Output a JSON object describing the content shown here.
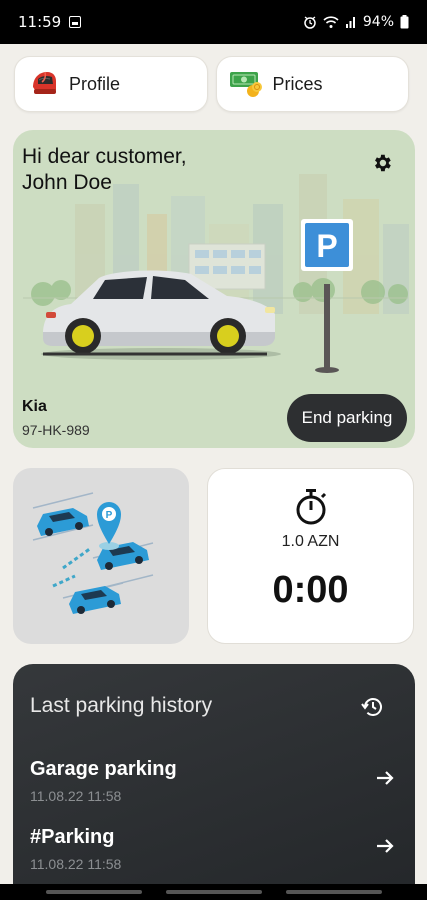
{
  "status_bar": {
    "time": "11:59",
    "battery": "94%"
  },
  "top_buttons": {
    "profile_label": "Profile",
    "prices_label": "Prices"
  },
  "parking_card": {
    "greeting_line1": "Hi dear customer,",
    "greeting_line2": "John Doe",
    "car_make": "Kia",
    "plate": "97-HK-989",
    "end_button": "End parking",
    "sign_letter": "P"
  },
  "timer": {
    "rate": "1.0 AZN",
    "elapsed": "0:00"
  },
  "history": {
    "title": "Last parking history",
    "items": [
      {
        "name": "Garage parking",
        "date": "11.08.22 11:58"
      },
      {
        "name": "#Parking",
        "date": "11.08.22 11:58"
      }
    ]
  },
  "colors": {
    "accent_dark": "#2d2f31",
    "card_green": "#cdddc2",
    "history_bg": "#2a2d30"
  }
}
